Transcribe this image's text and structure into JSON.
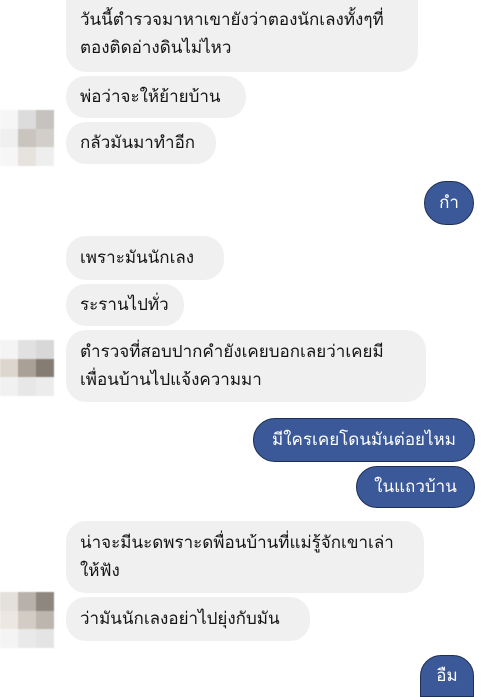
{
  "chat": {
    "messages": [
      {
        "side": "in",
        "text": "วันนี้ตำรวจมาหาเขายังว่าตองนักเลงทั้งๆที่\nตองติดอ่างดินไม่ไหว"
      },
      {
        "side": "in",
        "text": "พ่อว่าจะให้ย้ายบ้าน"
      },
      {
        "side": "in",
        "text": "กลัวมันมาทำอีก"
      },
      {
        "side": "out",
        "text": "กำ"
      },
      {
        "side": "in",
        "text": "เพราะมันนักเลง"
      },
      {
        "side": "in",
        "text": "ระรานไปทั่ว"
      },
      {
        "side": "in",
        "text": "ตำรวจที่สอบปากคำยังเคยบอกเลยว่าเคยมี\nเพื่อนบ้านไปแจ้งความมา"
      },
      {
        "side": "out",
        "text": "มีใครเคยโดนมันต่อยไหม"
      },
      {
        "side": "out",
        "text": "ในแถวบ้าน"
      },
      {
        "side": "in",
        "text": "น่าจะมีนะดพราะดพื่อนบ้านที่แม่รู้จักเขาเล่า\nให้ฟัง"
      },
      {
        "side": "in",
        "text": "ว่ามันนักเลงอย่าไปยุ่งกับมัน"
      },
      {
        "side": "out",
        "text": "อืม"
      }
    ]
  },
  "colors": {
    "incoming_bubble": "#f1f0f0",
    "incoming_text": "#141414",
    "outgoing_bubble": "#3b5998",
    "outgoing_text": "#ffffff"
  },
  "icons": {
    "avatar": "blurred-profile-photo"
  }
}
